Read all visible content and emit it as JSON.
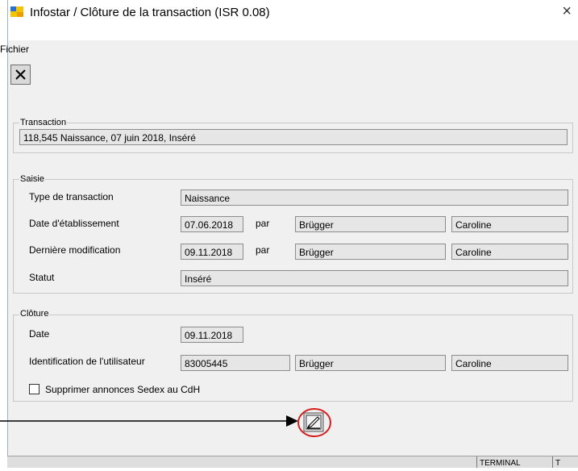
{
  "window": {
    "title": "Infostar / Clôture de la transaction (ISR 0.08)",
    "close_glyph": "×"
  },
  "menu": {
    "file": "Fichier"
  },
  "toolbar": {
    "cancel_glyph": "✕"
  },
  "transaction": {
    "legend": "Transaction",
    "value": "118,545  Naissance, 07 juin 2018, Inséré"
  },
  "saisie": {
    "legend": "Saisie",
    "type_label": "Type de transaction",
    "type_value": "Naissance",
    "date_label": "Date d'établissement",
    "date_value": "07.06.2018",
    "par1": "par",
    "date_lastname": "Brügger",
    "date_firstname": "Caroline",
    "mod_label": "Dernière modification",
    "mod_value": "09.11.2018",
    "par2": "par",
    "mod_lastname": "Brügger",
    "mod_firstname": "Caroline",
    "statut_label": "Statut",
    "statut_value": "Inséré"
  },
  "cloture": {
    "legend": "Clôture",
    "date_label": "Date",
    "date_value": "09.11.2018",
    "user_label": "Identification de l'utilisateur",
    "user_id": "83005445",
    "user_lastname": "Brügger",
    "user_firstname": "Caroline",
    "checkbox_label": "Supprimer annonces Sedex au CdH",
    "checkbox_checked": false
  },
  "status_bar": {
    "terminal": "TERMINAL",
    "t": "T"
  },
  "colors": {
    "highlight_circle": "#d62020",
    "arrow": "#000000"
  }
}
